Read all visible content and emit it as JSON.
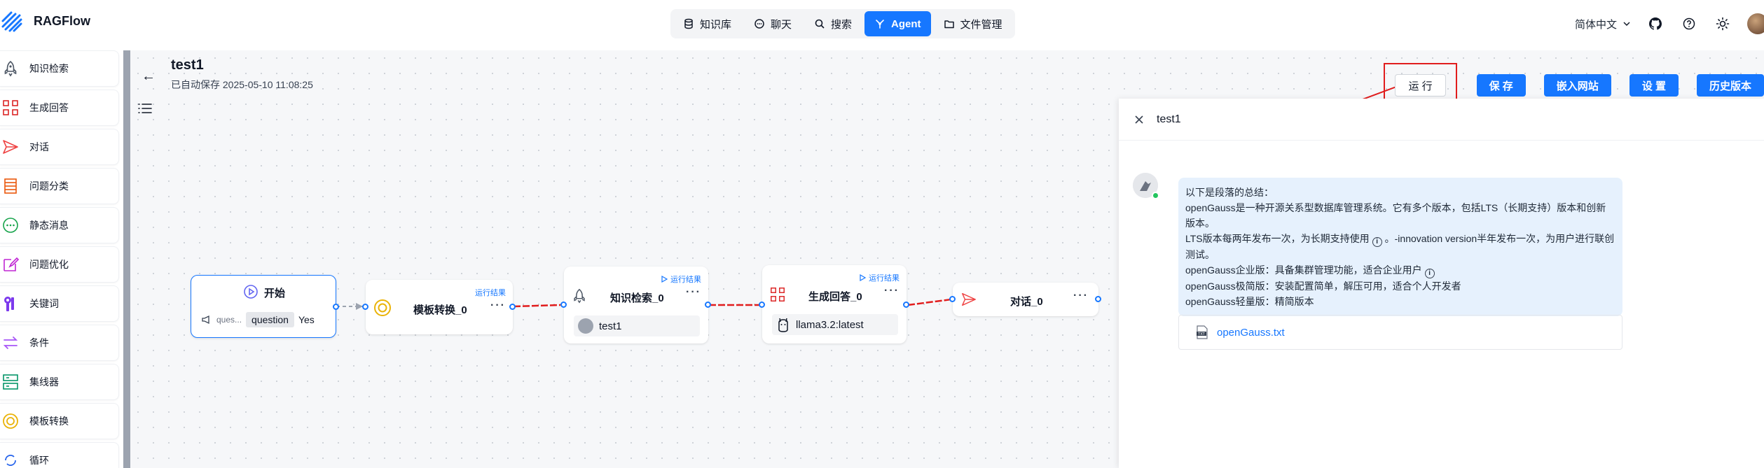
{
  "app": {
    "name": "RAGFlow"
  },
  "nav": [
    {
      "label": "知识库",
      "icon": "database-icon",
      "active": false
    },
    {
      "label": "聊天",
      "icon": "chat-icon",
      "active": false
    },
    {
      "label": "搜索",
      "icon": "search-icon",
      "active": false
    },
    {
      "label": "Agent",
      "icon": "agent-icon",
      "active": true
    },
    {
      "label": "文件管理",
      "icon": "folder-icon",
      "active": false
    }
  ],
  "header_right": {
    "language": "简体中文"
  },
  "sidebar": {
    "items": [
      {
        "label": "知识检索",
        "icon": "rocket-icon",
        "color": "#4b5563"
      },
      {
        "label": "生成回答",
        "icon": "generate-icon",
        "color": "#dc2626"
      },
      {
        "label": "对话",
        "icon": "send-icon",
        "color": "#ef4444"
      },
      {
        "label": "问题分类",
        "icon": "classify-icon",
        "color": "#ea580c"
      },
      {
        "label": "静态消息",
        "icon": "message-icon",
        "color": "#16a34a"
      },
      {
        "label": "问题优化",
        "icon": "edit-icon",
        "color": "#c026d3"
      },
      {
        "label": "关键词",
        "icon": "keyword-icon",
        "color": "#7c3aed"
      },
      {
        "label": "条件",
        "icon": "switch-icon",
        "color": "#a855f7"
      },
      {
        "label": "集线器",
        "icon": "hub-icon",
        "color": "#059669"
      },
      {
        "label": "模板转换",
        "icon": "template-icon",
        "color": "#eab308"
      },
      {
        "label": "循环",
        "icon": "loop-icon",
        "color": "#2563eb"
      }
    ]
  },
  "flow": {
    "title": "test1",
    "autosave": "已自动保存 2025-05-10 11:08:25"
  },
  "actions": {
    "run": "运 行",
    "save": "保 存",
    "embed": "嵌入网站",
    "settings": "设 置",
    "history": "历史版本"
  },
  "nodes": {
    "begin": {
      "title": "开始",
      "param_short": "ques...",
      "param_name": "question",
      "param_value": "Yes"
    },
    "template": {
      "title": "模板转换_0",
      "run_result": "运行结果"
    },
    "retrieval": {
      "title": "知识检索_0",
      "run_result": "运行结果",
      "kb": "test1"
    },
    "generate": {
      "title": "生成回答_0",
      "run_result": "运行结果",
      "model": "llama3.2:latest"
    },
    "answer": {
      "title": "对话_0"
    }
  },
  "chat": {
    "title": "test1",
    "message": {
      "lines": [
        "以下是段落的总结：",
        "openGauss是一种开源关系型数据库管理系统。它有多个版本，包括LTS（长期支持）版本和创新版本。",
        "LTS版本每两年发布一次，为长期支持使用",
        "。-innovation version半年发布一次，为用户进行联创测试。",
        "openGauss企业版：具备集群管理功能，适合企业用户",
        "openGauss极简版：安装配置简单，解压可用，适合个人开发者",
        "openGauss轻量版：精简版本"
      ]
    },
    "file": {
      "name": "openGauss.txt",
      "type": "TXT"
    }
  },
  "colors": {
    "accent": "#1677ff",
    "annotation_red": "#e11d1d",
    "edge_red": "#e11d1d"
  }
}
